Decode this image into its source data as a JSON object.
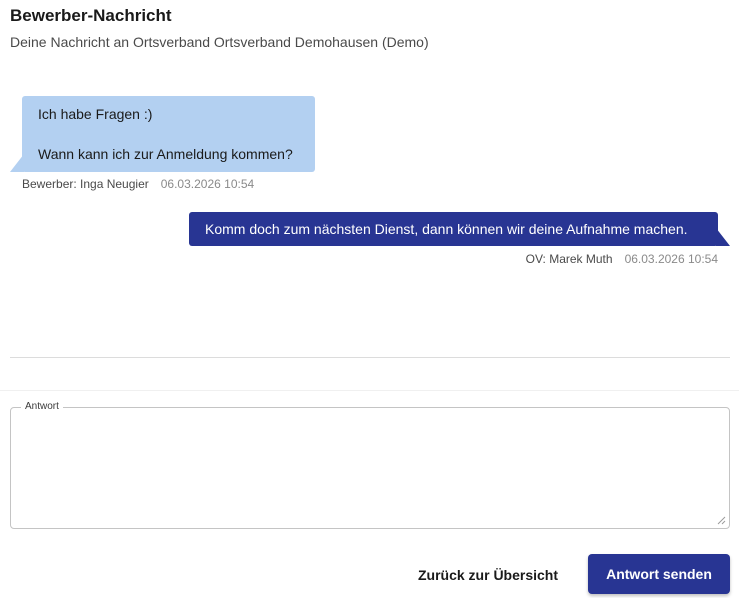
{
  "header": {
    "title": "Bewerber-Nachricht",
    "subtitle": "Deine Nachricht an Ortsverband Ortsverband Demohausen (Demo)"
  },
  "messages": [
    {
      "direction": "incoming",
      "lines": [
        "Ich habe Fragen :)",
        "Wann kann ich zur Anmeldung kommen?"
      ],
      "author": "Bewerber: Inga Neugier",
      "timestamp": "06.03.2026 10:54",
      "bubble_color": "#b3d0f1"
    },
    {
      "direction": "outgoing",
      "lines": [
        "Komm doch zum nächsten Dienst, dann können wir deine Aufnahme machen."
      ],
      "author": "OV: Marek Muth",
      "timestamp": "06.03.2026 10:54",
      "bubble_color": "#283593"
    }
  ],
  "reply": {
    "label": "Antwort",
    "value": ""
  },
  "actions": {
    "back_label": "Zurück zur Übersicht",
    "send_label": "Antwort senden"
  },
  "colors": {
    "primary": "#283593",
    "incoming_bubble": "#b3d0f1"
  },
  "icons": {
    "resize": "resize-grip-icon"
  }
}
